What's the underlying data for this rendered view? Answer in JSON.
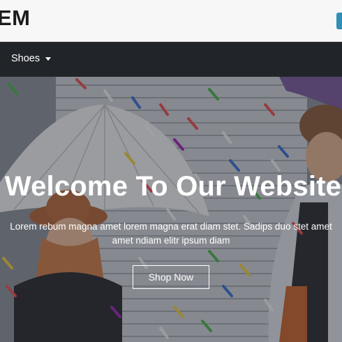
{
  "brand": {
    "logo_text": "EM"
  },
  "navbar": {
    "items": [
      {
        "label": "Shoes",
        "has_dropdown": true
      }
    ]
  },
  "hero": {
    "title": "Welcome To Our Website",
    "subtitle": "Lorem rebum magna amet lorem magna erat diam stet. Sadips duo stet amet amet ndiam elitr ipsum diam",
    "cta_label": "Shop Now",
    "background_image": "children-with-umbrellas-in-confetti"
  },
  "colors": {
    "navbar_bg": "#212529",
    "topbar_bg": "#f7f7f7",
    "accent": "#2e8fb8",
    "text_light": "#ffffff"
  }
}
